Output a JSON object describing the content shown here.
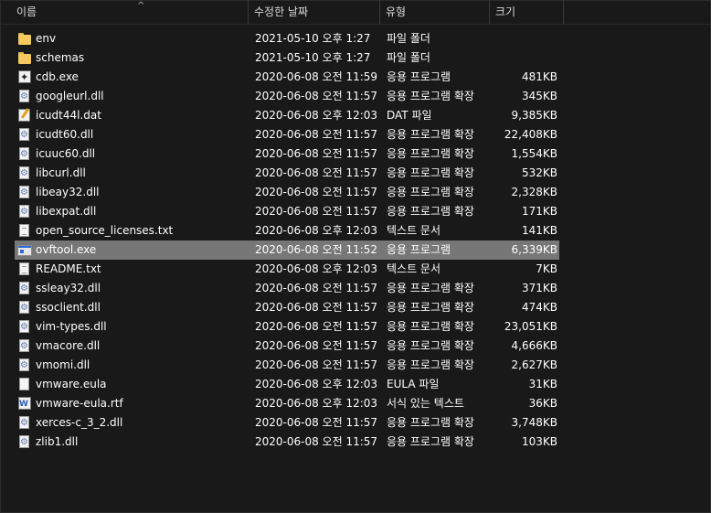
{
  "header": {
    "columns": [
      {
        "label": "이름"
      },
      {
        "label": "수정한 날짜"
      },
      {
        "label": "유형"
      },
      {
        "label": "크기"
      }
    ],
    "sort_arrow": "^"
  },
  "files": [
    {
      "name": "env",
      "date": "2021-05-10 오후 1:27",
      "type": "파일 폴더",
      "size": "",
      "icon": "folder-icon"
    },
    {
      "name": "schemas",
      "date": "2021-05-10 오후 1:27",
      "type": "파일 폴더",
      "size": "",
      "icon": "folder-icon"
    },
    {
      "name": "cdb.exe",
      "date": "2020-06-08 오전 11:59",
      "type": "응용 프로그램",
      "size": "481KB",
      "icon": "exe-icon"
    },
    {
      "name": "googleurl.dll",
      "date": "2020-06-08 오전 11:57",
      "type": "응용 프로그램 확장",
      "size": "345KB",
      "icon": "dll-icon"
    },
    {
      "name": "icudt44l.dat",
      "date": "2020-06-08 오후 12:03",
      "type": "DAT 파일",
      "size": "9,385KB",
      "icon": "dat-file-icon"
    },
    {
      "name": "icudt60.dll",
      "date": "2020-06-08 오전 11:57",
      "type": "응용 프로그램 확장",
      "size": "22,408KB",
      "icon": "dll-icon"
    },
    {
      "name": "icuuc60.dll",
      "date": "2020-06-08 오전 11:57",
      "type": "응용 프로그램 확장",
      "size": "1,554KB",
      "icon": "dll-icon"
    },
    {
      "name": "libcurl.dll",
      "date": "2020-06-08 오전 11:57",
      "type": "응용 프로그램 확장",
      "size": "532KB",
      "icon": "dll-icon"
    },
    {
      "name": "libeay32.dll",
      "date": "2020-06-08 오전 11:57",
      "type": "응용 프로그램 확장",
      "size": "2,328KB",
      "icon": "dll-icon"
    },
    {
      "name": "libexpat.dll",
      "date": "2020-06-08 오전 11:57",
      "type": "응용 프로그램 확장",
      "size": "171KB",
      "icon": "dll-icon"
    },
    {
      "name": "open_source_licenses.txt",
      "date": "2020-06-08 오후 12:03",
      "type": "텍스트 문서",
      "size": "141KB",
      "icon": "text-file-icon"
    },
    {
      "name": "ovftool.exe",
      "date": "2020-06-08 오전 11:52",
      "type": "응용 프로그램",
      "size": "6,339KB",
      "icon": "application-icon",
      "selected": true
    },
    {
      "name": "README.txt",
      "date": "2020-06-08 오후 12:03",
      "type": "텍스트 문서",
      "size": "7KB",
      "icon": "text-file-icon"
    },
    {
      "name": "ssleay32.dll",
      "date": "2020-06-08 오전 11:57",
      "type": "응용 프로그램 확장",
      "size": "371KB",
      "icon": "dll-icon"
    },
    {
      "name": "ssoclient.dll",
      "date": "2020-06-08 오전 11:57",
      "type": "응용 프로그램 확장",
      "size": "474KB",
      "icon": "dll-icon"
    },
    {
      "name": "vim-types.dll",
      "date": "2020-06-08 오전 11:57",
      "type": "응용 프로그램 확장",
      "size": "23,051KB",
      "icon": "dll-icon"
    },
    {
      "name": "vmacore.dll",
      "date": "2020-06-08 오전 11:57",
      "type": "응용 프로그램 확장",
      "size": "4,666KB",
      "icon": "dll-icon"
    },
    {
      "name": "vmomi.dll",
      "date": "2020-06-08 오전 11:57",
      "type": "응용 프로그램 확장",
      "size": "2,627KB",
      "icon": "dll-icon"
    },
    {
      "name": "vmware.eula",
      "date": "2020-06-08 오후 12:03",
      "type": "EULA 파일",
      "size": "31KB",
      "icon": "generic-file-icon"
    },
    {
      "name": "vmware-eula.rtf",
      "date": "2020-06-08 오후 12:03",
      "type": "서식 있는 텍스트",
      "size": "36KB",
      "icon": "rtf-document-icon"
    },
    {
      "name": "xerces-c_3_2.dll",
      "date": "2020-06-08 오전 11:57",
      "type": "응용 프로그램 확장",
      "size": "3,748KB",
      "icon": "dll-icon"
    },
    {
      "name": "zlib1.dll",
      "date": "2020-06-08 오전 11:57",
      "type": "응용 프로그램 확장",
      "size": "103KB",
      "icon": "dll-icon"
    }
  ]
}
